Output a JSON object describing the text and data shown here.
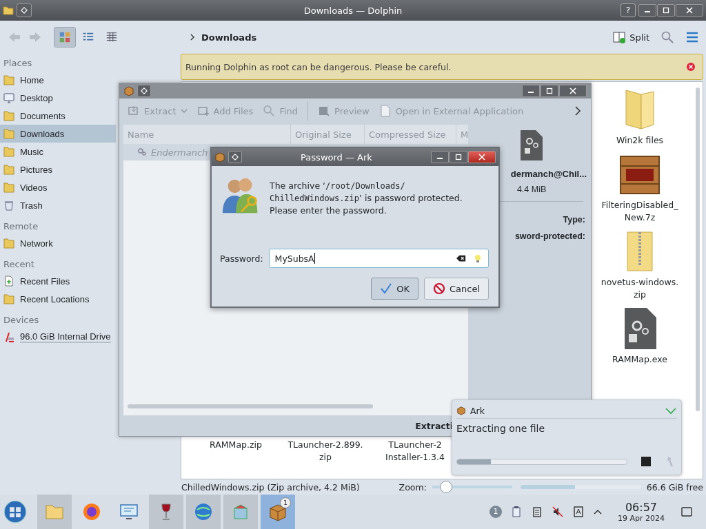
{
  "window": {
    "title": "Downloads — Dolphin",
    "help_label": "?"
  },
  "toolbar": {
    "view_modes": [
      {
        "kind": "icons",
        "selected": true
      },
      {
        "kind": "compact",
        "selected": false
      },
      {
        "kind": "details",
        "selected": false
      }
    ],
    "breadcrumb": "Downloads",
    "split_label": "Split"
  },
  "sidebar": {
    "sections": [
      {
        "title": "Places",
        "items": [
          {
            "label": "Home",
            "kind": "folder",
            "selected": false
          },
          {
            "label": "Desktop",
            "kind": "desktop",
            "selected": false
          },
          {
            "label": "Documents",
            "kind": "folder",
            "selected": false
          },
          {
            "label": "Downloads",
            "kind": "folder",
            "selected": true
          },
          {
            "label": "Music",
            "kind": "folder",
            "selected": false
          },
          {
            "label": "Pictures",
            "kind": "folder",
            "selected": false
          },
          {
            "label": "Videos",
            "kind": "folder",
            "selected": false
          },
          {
            "label": "Trash",
            "kind": "trash",
            "selected": false
          }
        ]
      },
      {
        "title": "Remote",
        "items": [
          {
            "label": "Network",
            "kind": "folder",
            "selected": false
          }
        ]
      },
      {
        "title": "Recent",
        "items": [
          {
            "label": "Recent Files",
            "kind": "document",
            "selected": false
          },
          {
            "label": "Recent Locations",
            "kind": "folder",
            "selected": false
          }
        ]
      },
      {
        "title": "Devices",
        "items": [
          {
            "label": "96.0 GiB Internal Drive",
            "kind": "drive",
            "selected": false
          }
        ]
      }
    ]
  },
  "banner": {
    "message": "Running Dolphin as root can be dangerous. Please be careful."
  },
  "files_right": [
    {
      "lines": [
        "Win2k files"
      ],
      "kind": "folder"
    },
    {
      "lines": [
        "FilteringDisabled_",
        "New.7z"
      ],
      "kind": "crate"
    },
    {
      "lines": [
        "novetus-windows.",
        "zip"
      ],
      "kind": "zip"
    },
    {
      "lines": [
        "RAMMap.exe"
      ],
      "kind": "exe"
    }
  ],
  "files_bottom": [
    {
      "lines": [
        "RAMMap.zip"
      ]
    },
    {
      "lines": [
        "TLauncher-2.899.",
        "zip"
      ]
    },
    {
      "lines": [
        "TLauncher-2",
        "Installer-1.3.4"
      ]
    }
  ],
  "status_bar": {
    "text": "ChilledWindows.zip (Zip archive, 4.2 MiB)",
    "zoom": {
      "label": "Zoom:",
      "level": 0.17
    },
    "free_space": {
      "label": "66.6 GiB free",
      "level": 0.45
    }
  },
  "ark": {
    "toolbar": [
      {
        "label": "Extract",
        "kind": "extract",
        "dropdown": true,
        "separator_before": false
      },
      {
        "label": "Add Files",
        "kind": "add",
        "dropdown": false,
        "separator_before": false
      },
      {
        "label": "Find",
        "kind": "find",
        "dropdown": false,
        "separator_before": false
      },
      {
        "label": "Preview",
        "kind": "preview",
        "dropdown": false,
        "separator_before": true
      },
      {
        "label": "Open in External Application",
        "kind": "open",
        "dropdown": false,
        "separator_before": false
      }
    ],
    "columns": [
      "Name",
      "Original Size",
      "Compressed Size",
      "M"
    ],
    "rows": [
      {
        "name": "Endermanch",
        "selected": true
      }
    ],
    "info": {
      "name": "dermanch@Chil...",
      "size": "4.4 MiB",
      "fields": [
        "Type:",
        "sword-protected:"
      ]
    },
    "status": "Extracti"
  },
  "dialog": {
    "title": "Password — Ark",
    "message": [
      {
        "kind": "text",
        "text": "The archive ‘"
      },
      {
        "kind": "code",
        "text": "/root/Downloads/"
      },
      {
        "kind": "code",
        "text": "ChilledWindows.zip"
      },
      {
        "kind": "text",
        "text": "’ is password protected. Please enter the password."
      }
    ],
    "label": "Password:",
    "value": "MySubsA",
    "buttons": [
      {
        "label": "OK",
        "kind": "ok",
        "selected": true
      },
      {
        "label": "Cancel",
        "kind": "cancel",
        "selected": false
      }
    ]
  },
  "notification": {
    "app": "Ark",
    "title": "Extracting one file",
    "level": 0.2
  },
  "taskbar": {
    "apps": [
      {
        "kind": "files",
        "running": true,
        "selected": false
      },
      {
        "kind": "browser",
        "running": false,
        "selected": false
      },
      {
        "kind": "remote",
        "running": false,
        "selected": false
      },
      {
        "kind": "wine",
        "running": true,
        "selected": false
      },
      {
        "kind": "globe",
        "running": true,
        "selected": false
      },
      {
        "kind": "package",
        "running": true,
        "selected": false
      },
      {
        "kind": "ark",
        "running": true,
        "selected": true,
        "badge": "1"
      }
    ],
    "tray_badge": "1",
    "time": "06:57",
    "date": "19 Apr 2024"
  }
}
